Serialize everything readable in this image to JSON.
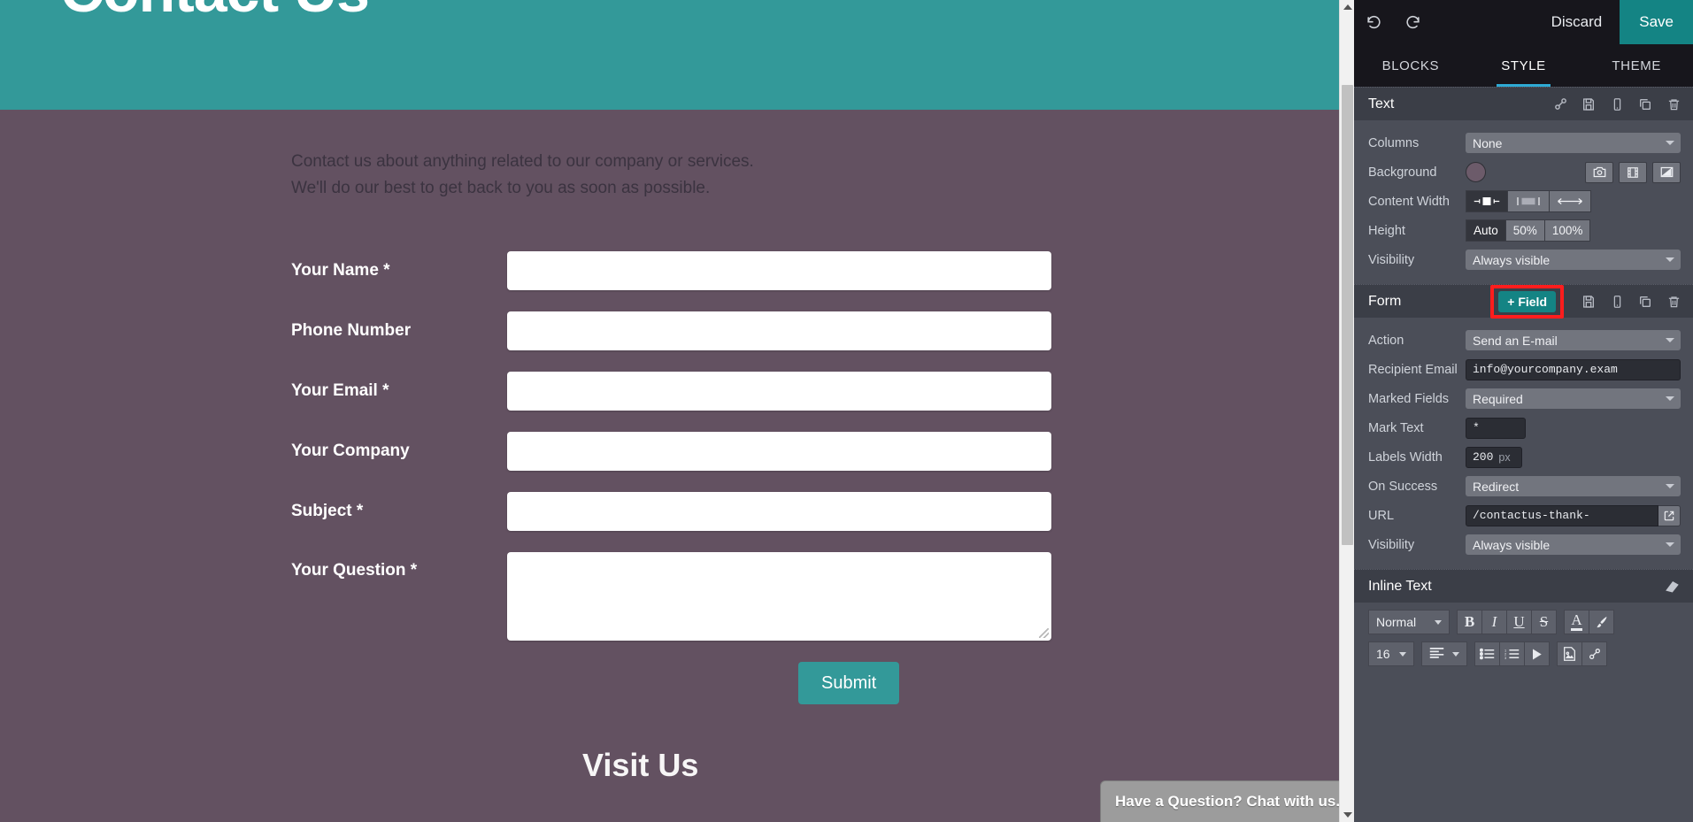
{
  "preview": {
    "hero_title": "Contact Us",
    "intro_line1": "Contact us about anything related to our company or services.",
    "intro_line2": "We'll do our best to get back to you as soon as possible.",
    "fields": [
      {
        "label": "Your Name",
        "mark": " *",
        "type": "input"
      },
      {
        "label": "Phone Number",
        "mark": "",
        "type": "input"
      },
      {
        "label": "Your Email",
        "mark": " *",
        "type": "input"
      },
      {
        "label": "Your Company",
        "mark": "",
        "type": "input"
      },
      {
        "label": "Subject",
        "mark": " *",
        "type": "input"
      },
      {
        "label": "Your Question",
        "mark": " *",
        "type": "textarea"
      }
    ],
    "submit_label": "Submit",
    "bottom_heading": "Visit Us",
    "chat_widget_label": "Have a Question? Chat with us.",
    "colors": {
      "hero": "#339999",
      "body": "#635161",
      "accent": "#339999"
    }
  },
  "editor": {
    "toolbar": {
      "undo_icon": "undo-icon",
      "redo_icon": "redo-icon",
      "discard_label": "Discard",
      "save_label": "Save",
      "save_color": "#148484"
    },
    "tabs": [
      {
        "label": "BLOCKS",
        "active": false
      },
      {
        "label": "STYLE",
        "active": true
      },
      {
        "label": "THEME",
        "active": false
      }
    ],
    "text_section": {
      "title": "Text",
      "icons": [
        "link-icon",
        "save-icon",
        "mobile-icon",
        "duplicate-icon",
        "trash-icon"
      ],
      "rows": {
        "columns_label": "Columns",
        "columns_value": "None",
        "background_label": "Background",
        "background_color": "#6c5b6a",
        "background_icons": [
          "camera-icon",
          "video-icon",
          "gradient-icon"
        ],
        "content_width_label": "Content Width",
        "content_width_options": [
          "narrow-icon",
          "medium-icon",
          "full-icon"
        ],
        "content_width_selected": 0,
        "height_label": "Height",
        "height_options": [
          "Auto",
          "50%",
          "100%"
        ],
        "height_selected": 0,
        "visibility_label": "Visibility",
        "visibility_value": "Always visible"
      }
    },
    "form_section": {
      "title": "Form",
      "add_field_label": "+ Field",
      "add_field_highlight_color": "#ff1d1d",
      "icons": [
        "save-icon",
        "mobile-icon",
        "duplicate-icon",
        "trash-icon"
      ],
      "rows": {
        "action_label": "Action",
        "action_value": "Send an E-mail",
        "recipient_label": "Recipient Email",
        "recipient_value": "info@yourcompany.exam",
        "marked_fields_label": "Marked Fields",
        "marked_fields_value": "Required",
        "mark_text_label": "Mark Text",
        "mark_text_value": "*",
        "labels_width_label": "Labels Width",
        "labels_width_value": "200",
        "labels_width_unit": "px",
        "on_success_label": "On Success",
        "on_success_value": "Redirect",
        "url_label": "URL",
        "url_value": "/contactus-thank-",
        "url_open_icon": "external-link-icon",
        "visibility_label": "Visibility",
        "visibility_value": "Always visible"
      }
    },
    "inline_text_section": {
      "title": "Inline Text",
      "eraser_icon": "eraser-icon",
      "style_value": "Normal",
      "bold_label": "B",
      "italic_label": "I",
      "underline_label": "U",
      "strike_label": "S",
      "font_color_icon": "font-color-icon",
      "highlight_icon": "brush-icon",
      "font_size_value": "16",
      "align_icon": "align-left-icon",
      "bullet_list_icon": "bullet-list-icon",
      "numbered_list_icon": "numbered-list-icon",
      "media_icon": "play-icon",
      "image_icon": "image-icon",
      "link_icon": "link-icon"
    }
  }
}
